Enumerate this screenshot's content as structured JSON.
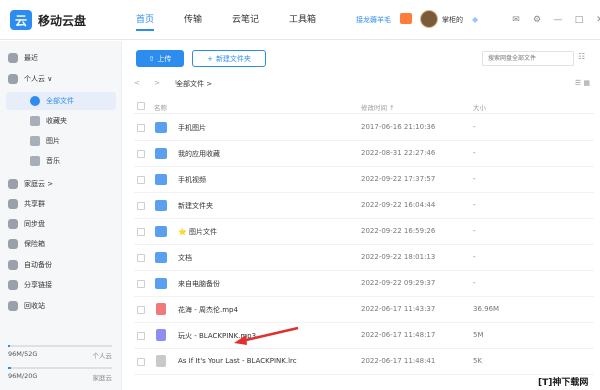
{
  "app": {
    "logo_glyph": "云",
    "title": "移动云盘"
  },
  "nav": [
    "首页",
    "传输",
    "云笔记",
    "工具箱"
  ],
  "promo": "接龙薅羊毛",
  "user": {
    "name": "掌柜的"
  },
  "sidebar": {
    "recent": "最近",
    "personal_cloud": "个人云 ∨",
    "all_files": "全部文件",
    "favorites": "收藏夹",
    "pictures": "图片",
    "music": "音乐",
    "family_cloud": "家庭云 >",
    "shared_group": "共享群",
    "sync_disk": "同步盘",
    "safe_box": "保险箱",
    "auto_backup": "自动备份",
    "share_links": "分享链接",
    "recycle_bin": "回收站",
    "storage_personal": {
      "used": "96M/52G",
      "label": "个人云",
      "fraction": 0.02
    },
    "storage_family": {
      "used": "96M/20G",
      "label": "家庭云",
      "fraction": 0.03
    }
  },
  "toolbar": {
    "upload": "上传",
    "new_folder": "新建文件夹",
    "search_placeholder": "搜索网盘全部文件"
  },
  "breadcrumb": {
    "arrows": "<  >  ↻",
    "path": "全部文件 >"
  },
  "table": {
    "col_name": "名称",
    "col_date": "修改时间 ↑",
    "col_size": "大小",
    "rows": [
      {
        "name": "手机图片",
        "date": "2017-06-16 21:10:36",
        "size": "-",
        "type": "folder"
      },
      {
        "name": "我的应用收藏",
        "date": "2022-08-31 22:27:46",
        "size": "-",
        "type": "folder"
      },
      {
        "name": "手机视频",
        "date": "2022-09-22 17:37:57",
        "size": "-",
        "type": "folder"
      },
      {
        "name": "新建文件夹",
        "date": "2022-09-22 16:04:44",
        "size": "-",
        "type": "folder"
      },
      {
        "name": "⭐ 图片文件",
        "date": "2022-09-22 16:59:26",
        "size": "-",
        "type": "folder"
      },
      {
        "name": "文档",
        "date": "2022-09-22 18:01:13",
        "size": "-",
        "type": "folder"
      },
      {
        "name": "来自电脑备份",
        "date": "2022-09-22 09:29:37",
        "size": "-",
        "type": "folder"
      },
      {
        "name": "花海 - 周杰伦.mp4",
        "date": "2022-06-17 11:43:37",
        "size": "36.96M",
        "type": "video"
      },
      {
        "name": "玩火 - BLACKPINK.mp3",
        "date": "2022-06-17 11:48:17",
        "size": "5M",
        "type": "audio"
      },
      {
        "name": "As If It's Your Last - BLACKPINK.lrc",
        "date": "2022-06-17 11:48:41",
        "size": "5K",
        "type": "file"
      }
    ]
  },
  "watermark": "[T]神下载网",
  "colors": {
    "accent": "#2d8cf0",
    "arrow": "#e03030"
  }
}
